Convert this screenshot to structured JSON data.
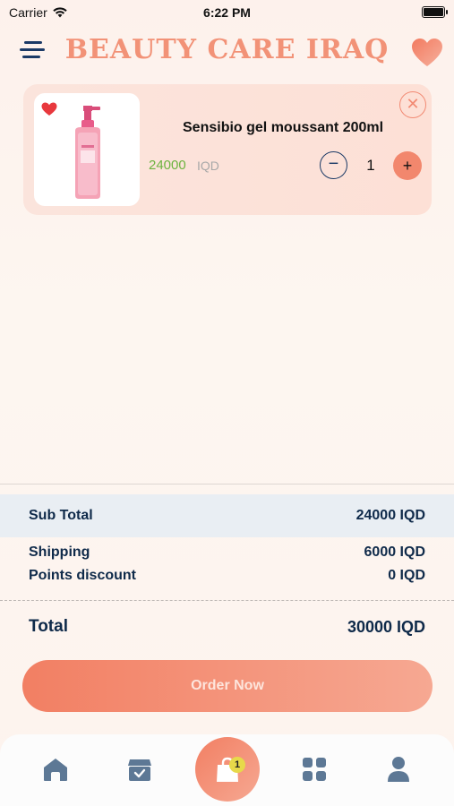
{
  "status_bar": {
    "carrier": "Carrier",
    "time": "6:22 PM"
  },
  "header": {
    "title": "BEAUTY CARE IRAQ",
    "menu_icon": "hamburger-menu-icon",
    "favorites_icon": "heart-icon"
  },
  "cart": {
    "items": [
      {
        "name": "Sensibio gel moussant 200ml",
        "price": "24000",
        "currency": "IQD",
        "quantity": "1",
        "minus_label": "−",
        "plus_label": "+",
        "remove_label": "✕",
        "favorited": true
      }
    ]
  },
  "summary": {
    "subtotal_label": "Sub Total",
    "subtotal_value": "24000 IQD",
    "shipping_label": "Shipping",
    "shipping_value": "6000 IQD",
    "points_label": "Points discount",
    "points_value": "0 IQD",
    "total_label": "Total",
    "total_value": "30000 IQD"
  },
  "order_button": {
    "label": "Order Now"
  },
  "tab_bar": {
    "tabs": [
      {
        "icon": "home-icon"
      },
      {
        "icon": "orders-box-icon"
      },
      {
        "icon": "shopping-bag-icon",
        "badge": "1",
        "active": true
      },
      {
        "icon": "categories-grid-icon"
      },
      {
        "icon": "profile-icon"
      }
    ]
  },
  "colors": {
    "accent": "#f27f63",
    "navy": "#0f2a4a",
    "price_green": "#6db33f",
    "badge_yellow": "#e7d94a"
  }
}
